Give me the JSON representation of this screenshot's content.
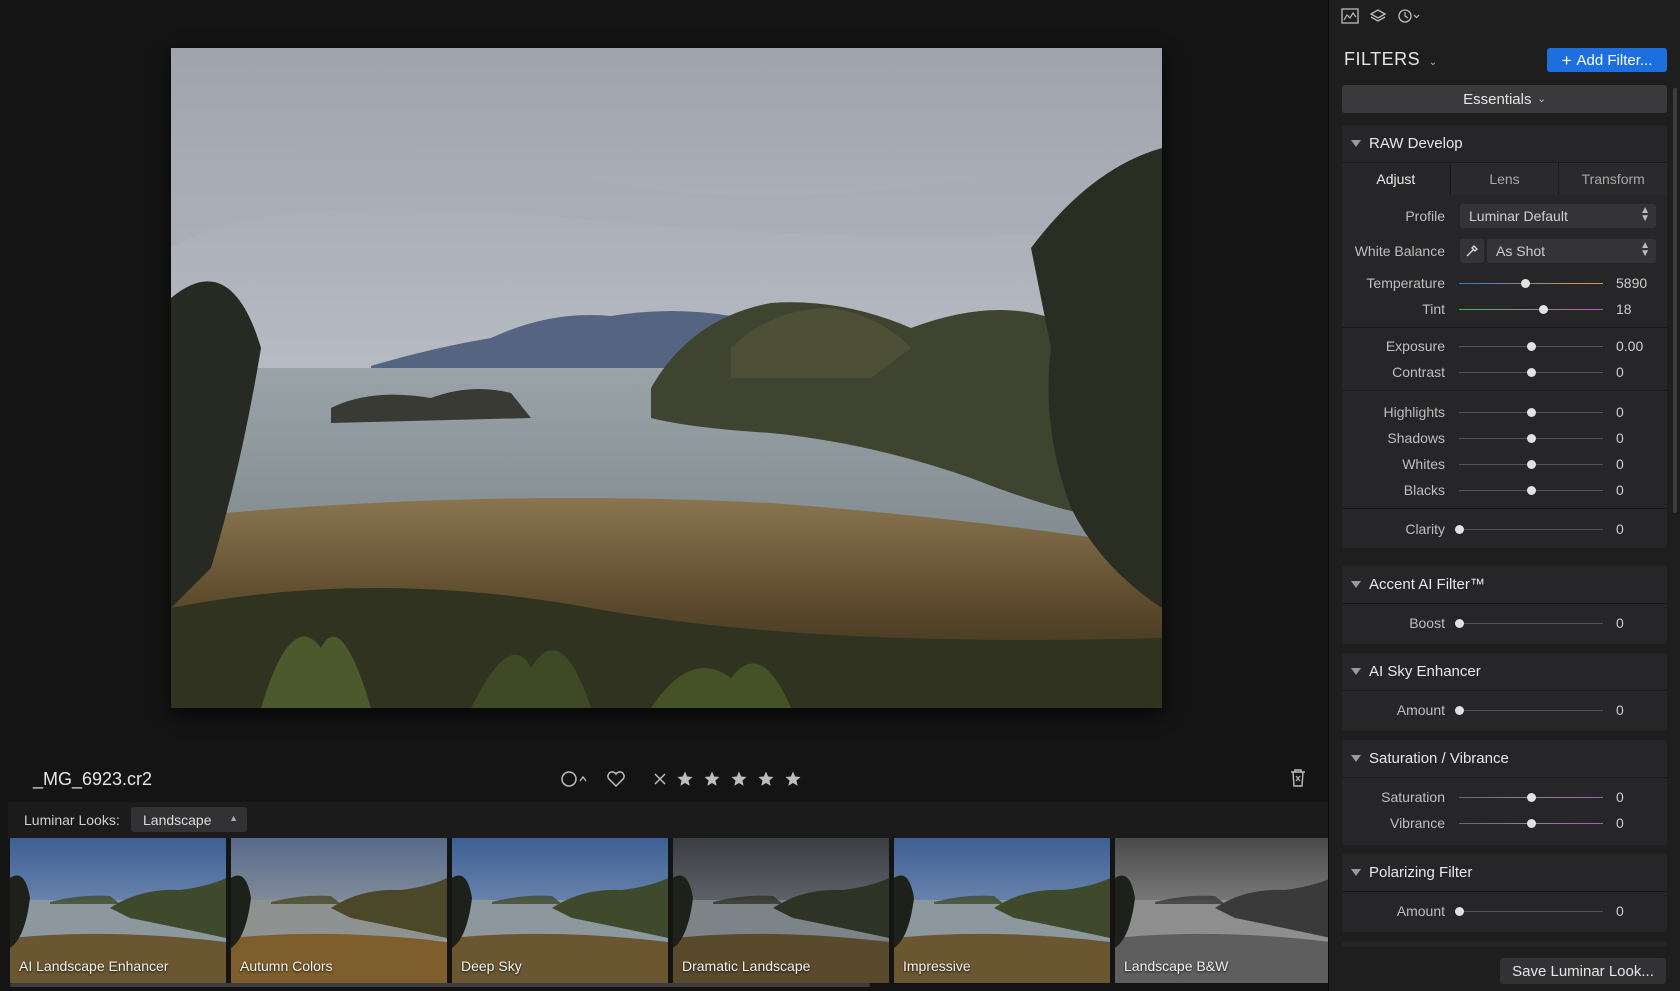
{
  "photo": {
    "filename": "_MG_6923.cr2"
  },
  "rating": {
    "stars": 0,
    "flag_icon": "circle-icon",
    "favorite_icon": "heart-icon",
    "reject_icon": "x-icon"
  },
  "looks": {
    "label": "Luminar Looks:",
    "category": "Landscape",
    "items": [
      {
        "name": "AI Landscape Enhancer",
        "tone": "vivid"
      },
      {
        "name": "Autumn Colors",
        "tone": "warm"
      },
      {
        "name": "Deep Sky",
        "tone": "vivid"
      },
      {
        "name": "Dramatic Landscape",
        "tone": "dramatic"
      },
      {
        "name": "Impressive",
        "tone": "vivid"
      },
      {
        "name": "Landscape B&W",
        "tone": "bw"
      }
    ]
  },
  "panel": {
    "title": "FILTERS",
    "add_filter": "Add Filter...",
    "workspace": "Essentials",
    "save_look": "Save Luminar Look...",
    "toolbar_icons": [
      "histogram-icon",
      "layers-icon",
      "history-icon"
    ]
  },
  "raw_develop": {
    "title": "RAW Develop",
    "tabs": [
      "Adjust",
      "Lens",
      "Transform"
    ],
    "active_tab": "Adjust",
    "profile_label": "Profile",
    "profile_value": "Luminar Default",
    "wb_label": "White Balance",
    "wb_value": "As Shot",
    "sliders": {
      "temperature": {
        "label": "Temperature",
        "value": "5890",
        "pos": 0.46
      },
      "tint": {
        "label": "Tint",
        "value": "18",
        "pos": 0.59
      },
      "exposure": {
        "label": "Exposure",
        "value": "0.00",
        "pos": 0.5
      },
      "contrast": {
        "label": "Contrast",
        "value": "0",
        "pos": 0.5
      },
      "highlights": {
        "label": "Highlights",
        "value": "0",
        "pos": 0.5
      },
      "shadows": {
        "label": "Shadows",
        "value": "0",
        "pos": 0.5
      },
      "whites": {
        "label": "Whites",
        "value": "0",
        "pos": 0.5
      },
      "blacks": {
        "label": "Blacks",
        "value": "0",
        "pos": 0.5
      },
      "clarity": {
        "label": "Clarity",
        "value": "0",
        "pos": 0.0
      }
    }
  },
  "accent_ai": {
    "title": "Accent AI Filter™",
    "boost": {
      "label": "Boost",
      "value": "0",
      "pos": 0.0
    }
  },
  "ai_sky": {
    "title": "AI Sky Enhancer",
    "amount": {
      "label": "Amount",
      "value": "0",
      "pos": 0.0
    }
  },
  "sat_vib": {
    "title": "Saturation / Vibrance",
    "saturation": {
      "label": "Saturation",
      "value": "0",
      "pos": 0.5
    },
    "vibrance": {
      "label": "Vibrance",
      "value": "0",
      "pos": 0.5
    }
  },
  "polarizing": {
    "title": "Polarizing Filter",
    "amount": {
      "label": "Amount",
      "value": "0",
      "pos": 0.0
    }
  },
  "colors": {
    "accent": "#1d6fe0",
    "panel_bg": "#1e1e1f",
    "group_bg": "#262628"
  }
}
